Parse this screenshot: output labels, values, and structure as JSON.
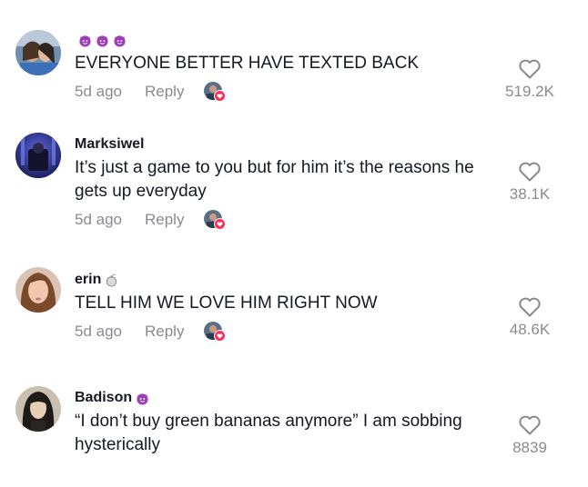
{
  "comments": [
    {
      "username": "",
      "username_emoji": "devil-emoji",
      "text": "EVERYONE BETTER HAVE TEXTED BACK",
      "age": "5d ago",
      "reply_label": "Reply",
      "likes": "519.2K"
    },
    {
      "username": "Marksiwel",
      "text": "It’s just a game to you but for him it’s the reasons he gets up everyday",
      "age": "5d ago",
      "reply_label": "Reply",
      "likes": "38.1K"
    },
    {
      "username": "erin",
      "username_emoji": "bomb-emoji",
      "text": "TELL HIM WE LOVE HIM RIGHT NOW",
      "age": "5d ago",
      "reply_label": "Reply",
      "likes": "48.6K"
    },
    {
      "username": "Badison",
      "username_emoji": "devil-emoji",
      "text": "“I don’t buy green bananas anymore” I am sobbing hysterically",
      "likes": "8839"
    }
  ],
  "colors": {
    "text": "#161823",
    "muted": "#8a8b91",
    "like_badge": "#fe2c55",
    "devil_emoji": "#9b3fb5"
  }
}
